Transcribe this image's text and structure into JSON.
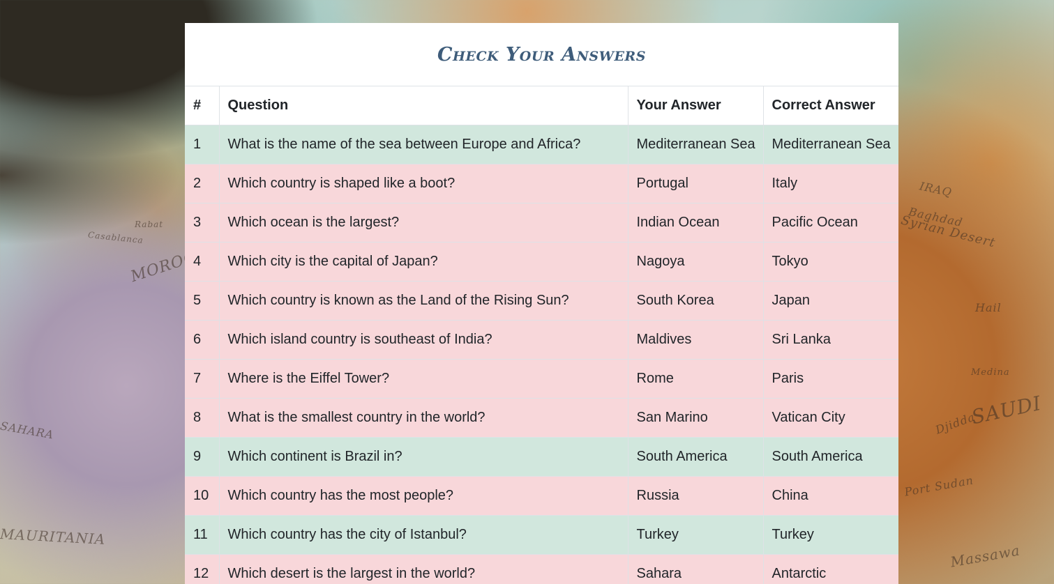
{
  "page": {
    "title": "Check Your Answers"
  },
  "table": {
    "headers": [
      "#",
      "Question",
      "Your Answer",
      "Correct Answer"
    ],
    "rows": [
      {
        "num": "1",
        "question": "What is the name of the sea between Europe and Africa?",
        "your_answer": "Mediterranean Sea",
        "correct_answer": "Mediterranean Sea",
        "status": "correct"
      },
      {
        "num": "2",
        "question": "Which country is shaped like a boot?",
        "your_answer": "Portugal",
        "correct_answer": "Italy",
        "status": "wrong"
      },
      {
        "num": "3",
        "question": "Which ocean is the largest?",
        "your_answer": "Indian Ocean",
        "correct_answer": "Pacific Ocean",
        "status": "wrong"
      },
      {
        "num": "4",
        "question": "Which city is the capital of Japan?",
        "your_answer": "Nagoya",
        "correct_answer": "Tokyo",
        "status": "wrong"
      },
      {
        "num": "5",
        "question": "Which country is known as the Land of the Rising Sun?",
        "your_answer": "South Korea",
        "correct_answer": "Japan",
        "status": "wrong"
      },
      {
        "num": "6",
        "question": "Which island country is southeast of India?",
        "your_answer": "Maldives",
        "correct_answer": "Sri Lanka",
        "status": "wrong"
      },
      {
        "num": "7",
        "question": "Where is the Eiffel Tower?",
        "your_answer": "Rome",
        "correct_answer": "Paris",
        "status": "wrong"
      },
      {
        "num": "8",
        "question": "What is the smallest country in the world?",
        "your_answer": "San Marino",
        "correct_answer": "Vatican City",
        "status": "wrong"
      },
      {
        "num": "9",
        "question": "Which continent is Brazil in?",
        "your_answer": "South America",
        "correct_answer": "South America",
        "status": "correct"
      },
      {
        "num": "10",
        "question": "Which country has the most people?",
        "your_answer": "Russia",
        "correct_answer": "China",
        "status": "wrong"
      },
      {
        "num": "11",
        "question": "Which country has the city of Istanbul?",
        "your_answer": "Turkey",
        "correct_answer": "Turkey",
        "status": "correct"
      },
      {
        "num": "12",
        "question": "Which desert is the largest in the world?",
        "your_answer": "Sahara",
        "correct_answer": "Antarctic",
        "status": "wrong"
      }
    ]
  },
  "colors": {
    "correct_row": "#d1e7dd",
    "wrong_row": "#f8d7da",
    "title": "#3e5c7a"
  },
  "background": {
    "labels": [
      "MOROCCO",
      "MAURITANIA",
      "SAHARA",
      "SAUDI",
      "IRAQ",
      "Baghdad",
      "Syrian Desert",
      "Casablanca",
      "Rabat",
      "Medina",
      "Hail",
      "Massawa",
      "Port Sudan",
      "Djidda"
    ]
  }
}
